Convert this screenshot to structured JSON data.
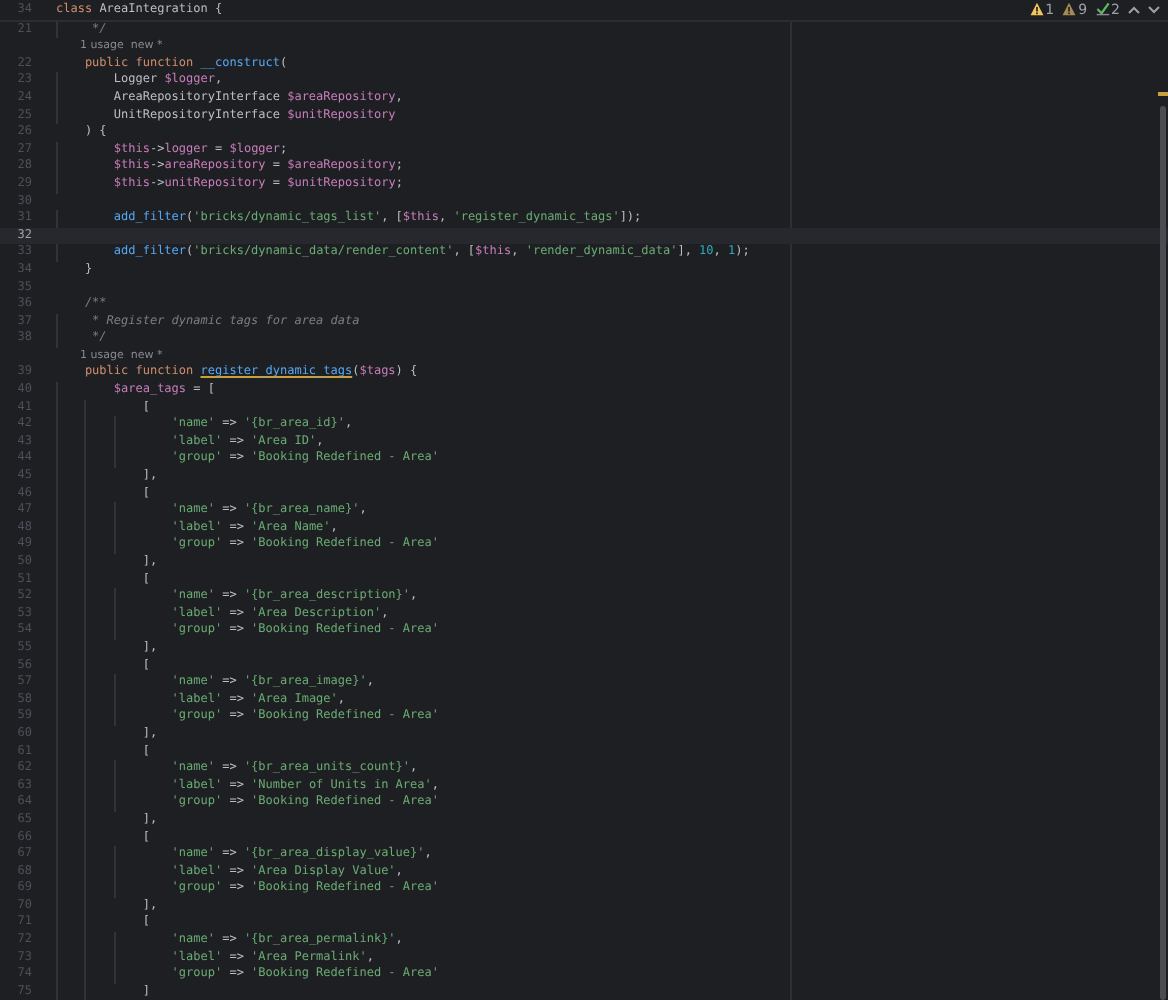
{
  "sticky_header": {
    "number": "34",
    "tokens": [
      {
        "kind": "keyword",
        "text": "class "
      },
      {
        "kind": "plain",
        "text": "AreaIntegration {"
      }
    ]
  },
  "inspections": [
    {
      "kind": "warning",
      "count": "1"
    },
    {
      "kind": "weak-warning",
      "count": "9"
    },
    {
      "kind": "typo",
      "count": "2"
    }
  ],
  "lines": [
    {
      "kind": "code",
      "number": "21",
      "current": false,
      "tokens": [
        {
          "kind": "comment",
          "text": "     */"
        }
      ]
    },
    {
      "kind": "hint",
      "text": "1 usage  new *"
    },
    {
      "kind": "code",
      "number": "22",
      "current": false,
      "tokens": [
        {
          "kind": "keyword",
          "text": "    public function "
        },
        {
          "kind": "fn",
          "text": "__construct"
        },
        {
          "kind": "plain",
          "text": "("
        }
      ]
    },
    {
      "kind": "code",
      "number": "23",
      "current": false,
      "tokens": [
        {
          "kind": "plain",
          "text": "        Logger "
        },
        {
          "kind": "var",
          "text": "$logger"
        },
        {
          "kind": "plain",
          "text": ","
        }
      ]
    },
    {
      "kind": "code",
      "number": "24",
      "current": false,
      "tokens": [
        {
          "kind": "plain",
          "text": "        AreaRepositoryInterface "
        },
        {
          "kind": "var",
          "text": "$areaRepository"
        },
        {
          "kind": "plain",
          "text": ","
        }
      ]
    },
    {
      "kind": "code",
      "number": "25",
      "current": false,
      "tokens": [
        {
          "kind": "plain",
          "text": "        UnitRepositoryInterface "
        },
        {
          "kind": "var",
          "text": "$unitRepository"
        }
      ]
    },
    {
      "kind": "code",
      "number": "26",
      "current": false,
      "tokens": [
        {
          "kind": "plain",
          "text": "    ) {"
        }
      ]
    },
    {
      "kind": "code",
      "number": "27",
      "current": false,
      "tokens": [
        {
          "kind": "var",
          "text": "        $this"
        },
        {
          "kind": "plain",
          "text": "->"
        },
        {
          "kind": "var",
          "text": "logger"
        },
        {
          "kind": "plain",
          "text": " = "
        },
        {
          "kind": "var",
          "text": "$logger"
        },
        {
          "kind": "plain",
          "text": ";"
        }
      ]
    },
    {
      "kind": "code",
      "number": "28",
      "current": false,
      "tokens": [
        {
          "kind": "var",
          "text": "        $this"
        },
        {
          "kind": "plain",
          "text": "->"
        },
        {
          "kind": "var",
          "text": "areaRepository"
        },
        {
          "kind": "plain",
          "text": " = "
        },
        {
          "kind": "var",
          "text": "$areaRepository"
        },
        {
          "kind": "plain",
          "text": ";"
        }
      ]
    },
    {
      "kind": "code",
      "number": "29",
      "current": false,
      "tokens": [
        {
          "kind": "var",
          "text": "        $this"
        },
        {
          "kind": "plain",
          "text": "->"
        },
        {
          "kind": "var",
          "text": "unitRepository"
        },
        {
          "kind": "plain",
          "text": " = "
        },
        {
          "kind": "var",
          "text": "$unitRepository"
        },
        {
          "kind": "plain",
          "text": ";"
        }
      ]
    },
    {
      "kind": "code",
      "number": "30",
      "current": false
    },
    {
      "kind": "code",
      "number": "31",
      "current": false,
      "tokens": [
        {
          "kind": "fn",
          "text": "        add_filter"
        },
        {
          "kind": "plain",
          "text": "("
        },
        {
          "kind": "string",
          "text": "'bricks/dynamic_tags_list'"
        },
        {
          "kind": "plain",
          "text": ", ["
        },
        {
          "kind": "var",
          "text": "$this"
        },
        {
          "kind": "plain",
          "text": ", "
        },
        {
          "kind": "string",
          "text": "'register_dynamic_tags'"
        },
        {
          "kind": "plain",
          "text": "]);"
        }
      ]
    },
    {
      "kind": "code",
      "number": "32",
      "current": true
    },
    {
      "kind": "code",
      "number": "33",
      "current": false,
      "tokens": [
        {
          "kind": "fn",
          "text": "        add_filter"
        },
        {
          "kind": "plain",
          "text": "("
        },
        {
          "kind": "string",
          "text": "'bricks/dynamic_data/render_content'"
        },
        {
          "kind": "plain",
          "text": ", ["
        },
        {
          "kind": "var",
          "text": "$this"
        },
        {
          "kind": "plain",
          "text": ", "
        },
        {
          "kind": "string",
          "text": "'render_dynamic_data'"
        },
        {
          "kind": "plain",
          "text": "], "
        },
        {
          "kind": "number",
          "text": "10"
        },
        {
          "kind": "plain",
          "text": ", "
        },
        {
          "kind": "number",
          "text": "1"
        },
        {
          "kind": "plain",
          "text": ");"
        }
      ]
    },
    {
      "kind": "code",
      "number": "34",
      "current": false,
      "tokens": [
        {
          "kind": "plain",
          "text": "    }"
        }
      ]
    },
    {
      "kind": "code",
      "number": "35",
      "current": false
    },
    {
      "kind": "code",
      "number": "36",
      "current": false,
      "tokens": [
        {
          "kind": "comment",
          "text": "    /**"
        }
      ]
    },
    {
      "kind": "code",
      "number": "37",
      "current": false,
      "tokens": [
        {
          "kind": "comment",
          "text": "     * Register dynamic tags for area data"
        }
      ]
    },
    {
      "kind": "code",
      "number": "38",
      "current": false,
      "tokens": [
        {
          "kind": "comment",
          "text": "     */"
        }
      ]
    },
    {
      "kind": "hint",
      "text": "1 usage  new *"
    },
    {
      "kind": "code",
      "number": "39",
      "current": false,
      "tokens": [
        {
          "kind": "keyword",
          "text": "    public function "
        },
        {
          "kind": "fn-decl",
          "text": "register_dynamic_tags"
        },
        {
          "kind": "plain",
          "text": "("
        },
        {
          "kind": "var",
          "text": "$tags"
        },
        {
          "kind": "plain",
          "text": ") {"
        }
      ]
    },
    {
      "kind": "code",
      "number": "40",
      "current": false,
      "tokens": [
        {
          "kind": "var",
          "text": "        $area_tags"
        },
        {
          "kind": "plain",
          "text": " = ["
        }
      ]
    },
    {
      "kind": "code",
      "number": "41",
      "current": false,
      "tokens": [
        {
          "kind": "plain",
          "text": "            ["
        }
      ]
    },
    {
      "kind": "code",
      "number": "42",
      "current": false,
      "tokens": [
        {
          "kind": "string",
          "text": "                'name'"
        },
        {
          "kind": "plain",
          "text": " => "
        },
        {
          "kind": "string",
          "text": "'{br_area_id}'"
        },
        {
          "kind": "plain",
          "text": ","
        }
      ]
    },
    {
      "kind": "code",
      "number": "43",
      "current": false,
      "tokens": [
        {
          "kind": "string",
          "text": "                'label'"
        },
        {
          "kind": "plain",
          "text": " => "
        },
        {
          "kind": "string",
          "text": "'Area ID'"
        },
        {
          "kind": "plain",
          "text": ","
        }
      ]
    },
    {
      "kind": "code",
      "number": "44",
      "current": false,
      "tokens": [
        {
          "kind": "string",
          "text": "                'group'"
        },
        {
          "kind": "plain",
          "text": " => "
        },
        {
          "kind": "string",
          "text": "'Booking Redefined - Area'"
        }
      ]
    },
    {
      "kind": "code",
      "number": "45",
      "current": false,
      "tokens": [
        {
          "kind": "plain",
          "text": "            ],"
        }
      ]
    },
    {
      "kind": "code",
      "number": "46",
      "current": false,
      "tokens": [
        {
          "kind": "plain",
          "text": "            ["
        }
      ]
    },
    {
      "kind": "code",
      "number": "47",
      "current": false,
      "tokens": [
        {
          "kind": "string",
          "text": "                'name'"
        },
        {
          "kind": "plain",
          "text": " => "
        },
        {
          "kind": "string",
          "text": "'{br_area_name}'"
        },
        {
          "kind": "plain",
          "text": ","
        }
      ]
    },
    {
      "kind": "code",
      "number": "48",
      "current": false,
      "tokens": [
        {
          "kind": "string",
          "text": "                'label'"
        },
        {
          "kind": "plain",
          "text": " => "
        },
        {
          "kind": "string",
          "text": "'Area Name'"
        },
        {
          "kind": "plain",
          "text": ","
        }
      ]
    },
    {
      "kind": "code",
      "number": "49",
      "current": false,
      "tokens": [
        {
          "kind": "string",
          "text": "                'group'"
        },
        {
          "kind": "plain",
          "text": " => "
        },
        {
          "kind": "string",
          "text": "'Booking Redefined - Area'"
        }
      ]
    },
    {
      "kind": "code",
      "number": "50",
      "current": false,
      "tokens": [
        {
          "kind": "plain",
          "text": "            ],"
        }
      ]
    },
    {
      "kind": "code",
      "number": "51",
      "current": false,
      "tokens": [
        {
          "kind": "plain",
          "text": "            ["
        }
      ]
    },
    {
      "kind": "code",
      "number": "52",
      "current": false,
      "tokens": [
        {
          "kind": "string",
          "text": "                'name'"
        },
        {
          "kind": "plain",
          "text": " => "
        },
        {
          "kind": "string",
          "text": "'{br_area_description}'"
        },
        {
          "kind": "plain",
          "text": ","
        }
      ]
    },
    {
      "kind": "code",
      "number": "53",
      "current": false,
      "tokens": [
        {
          "kind": "string",
          "text": "                'label'"
        },
        {
          "kind": "plain",
          "text": " => "
        },
        {
          "kind": "string",
          "text": "'Area Description'"
        },
        {
          "kind": "plain",
          "text": ","
        }
      ]
    },
    {
      "kind": "code",
      "number": "54",
      "current": false,
      "tokens": [
        {
          "kind": "string",
          "text": "                'group'"
        },
        {
          "kind": "plain",
          "text": " => "
        },
        {
          "kind": "string",
          "text": "'Booking Redefined - Area'"
        }
      ]
    },
    {
      "kind": "code",
      "number": "55",
      "current": false,
      "tokens": [
        {
          "kind": "plain",
          "text": "            ],"
        }
      ]
    },
    {
      "kind": "code",
      "number": "56",
      "current": false,
      "tokens": [
        {
          "kind": "plain",
          "text": "            ["
        }
      ]
    },
    {
      "kind": "code",
      "number": "57",
      "current": false,
      "tokens": [
        {
          "kind": "string",
          "text": "                'name'"
        },
        {
          "kind": "plain",
          "text": " => "
        },
        {
          "kind": "string",
          "text": "'{br_area_image}'"
        },
        {
          "kind": "plain",
          "text": ","
        }
      ]
    },
    {
      "kind": "code",
      "number": "58",
      "current": false,
      "tokens": [
        {
          "kind": "string",
          "text": "                'label'"
        },
        {
          "kind": "plain",
          "text": " => "
        },
        {
          "kind": "string",
          "text": "'Area Image'"
        },
        {
          "kind": "plain",
          "text": ","
        }
      ]
    },
    {
      "kind": "code",
      "number": "59",
      "current": false,
      "tokens": [
        {
          "kind": "string",
          "text": "                'group'"
        },
        {
          "kind": "plain",
          "text": " => "
        },
        {
          "kind": "string",
          "text": "'Booking Redefined - Area'"
        }
      ]
    },
    {
      "kind": "code",
      "number": "60",
      "current": false,
      "tokens": [
        {
          "kind": "plain",
          "text": "            ],"
        }
      ]
    },
    {
      "kind": "code",
      "number": "61",
      "current": false,
      "tokens": [
        {
          "kind": "plain",
          "text": "            ["
        }
      ]
    },
    {
      "kind": "code",
      "number": "62",
      "current": false,
      "tokens": [
        {
          "kind": "string",
          "text": "                'name'"
        },
        {
          "kind": "plain",
          "text": " => "
        },
        {
          "kind": "string",
          "text": "'{br_area_units_count}'"
        },
        {
          "kind": "plain",
          "text": ","
        }
      ]
    },
    {
      "kind": "code",
      "number": "63",
      "current": false,
      "tokens": [
        {
          "kind": "string",
          "text": "                'label'"
        },
        {
          "kind": "plain",
          "text": " => "
        },
        {
          "kind": "string",
          "text": "'Number of Units in Area'"
        },
        {
          "kind": "plain",
          "text": ","
        }
      ]
    },
    {
      "kind": "code",
      "number": "64",
      "current": false,
      "tokens": [
        {
          "kind": "string",
          "text": "                'group'"
        },
        {
          "kind": "plain",
          "text": " => "
        },
        {
          "kind": "string",
          "text": "'Booking Redefined - Area'"
        }
      ]
    },
    {
      "kind": "code",
      "number": "65",
      "current": false,
      "tokens": [
        {
          "kind": "plain",
          "text": "            ],"
        }
      ]
    },
    {
      "kind": "code",
      "number": "66",
      "current": false,
      "tokens": [
        {
          "kind": "plain",
          "text": "            ["
        }
      ]
    },
    {
      "kind": "code",
      "number": "67",
      "current": false,
      "tokens": [
        {
          "kind": "string",
          "text": "                'name'"
        },
        {
          "kind": "plain",
          "text": " => "
        },
        {
          "kind": "string",
          "text": "'{br_area_display_value}'"
        },
        {
          "kind": "plain",
          "text": ","
        }
      ]
    },
    {
      "kind": "code",
      "number": "68",
      "current": false,
      "tokens": [
        {
          "kind": "string",
          "text": "                'label'"
        },
        {
          "kind": "plain",
          "text": " => "
        },
        {
          "kind": "string",
          "text": "'Area Display Value'"
        },
        {
          "kind": "plain",
          "text": ","
        }
      ]
    },
    {
      "kind": "code",
      "number": "69",
      "current": false,
      "tokens": [
        {
          "kind": "string",
          "text": "                'group'"
        },
        {
          "kind": "plain",
          "text": " => "
        },
        {
          "kind": "string",
          "text": "'Booking Redefined - Area'"
        }
      ]
    },
    {
      "kind": "code",
      "number": "70",
      "current": false,
      "tokens": [
        {
          "kind": "plain",
          "text": "            ],"
        }
      ]
    },
    {
      "kind": "code",
      "number": "71",
      "current": false,
      "tokens": [
        {
          "kind": "plain",
          "text": "            ["
        }
      ]
    },
    {
      "kind": "code",
      "number": "72",
      "current": false,
      "tokens": [
        {
          "kind": "string",
          "text": "                'name'"
        },
        {
          "kind": "plain",
          "text": " => "
        },
        {
          "kind": "string",
          "text": "'{br_area_permalink}'"
        },
        {
          "kind": "plain",
          "text": ","
        }
      ]
    },
    {
      "kind": "code",
      "number": "73",
      "current": false,
      "tokens": [
        {
          "kind": "string",
          "text": "                'label'"
        },
        {
          "kind": "plain",
          "text": " => "
        },
        {
          "kind": "string",
          "text": "'Area Permalink'"
        },
        {
          "kind": "plain",
          "text": ","
        }
      ]
    },
    {
      "kind": "code",
      "number": "74",
      "current": false,
      "tokens": [
        {
          "kind": "string",
          "text": "                'group'"
        },
        {
          "kind": "plain",
          "text": " => "
        },
        {
          "kind": "string",
          "text": "'Booking Redefined - Area'"
        }
      ]
    },
    {
      "kind": "code",
      "number": "75",
      "current": false,
      "tokens": [
        {
          "kind": "plain",
          "text": "            ]"
        }
      ]
    }
  ]
}
